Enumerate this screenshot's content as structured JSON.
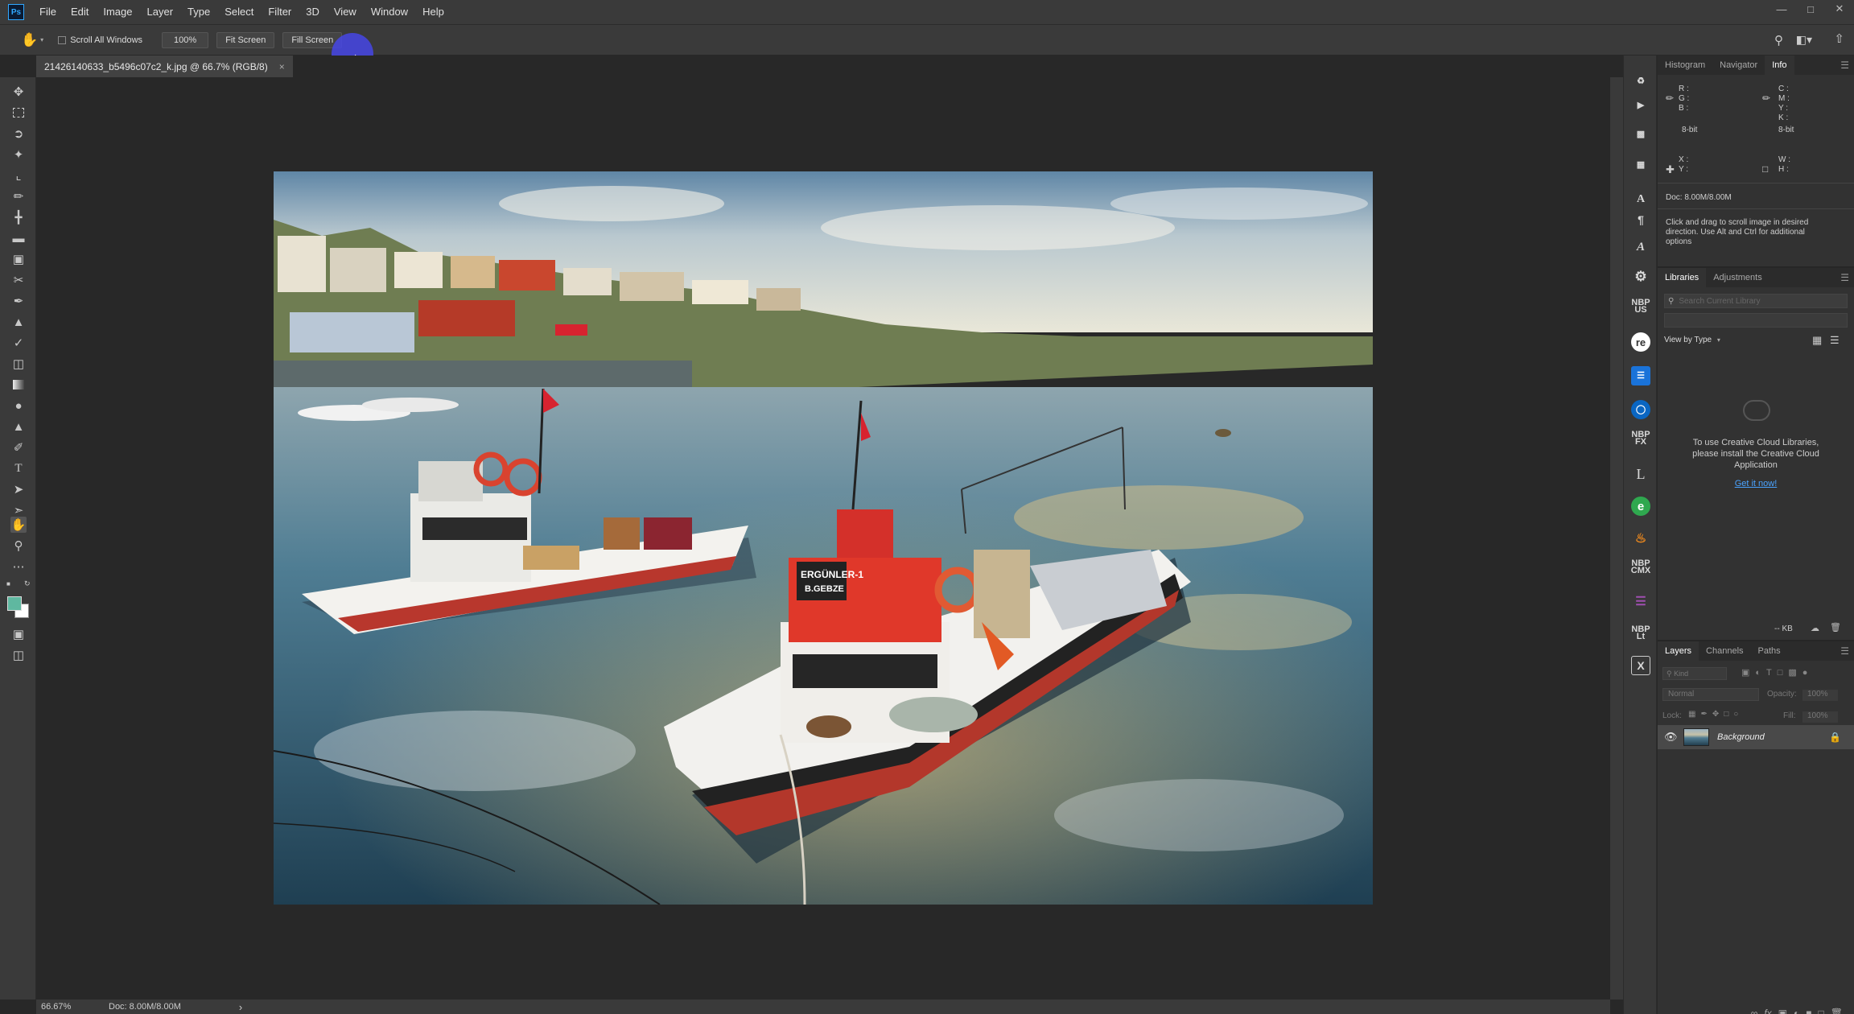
{
  "app": {
    "logo": "Ps"
  },
  "menu": [
    "File",
    "Edit",
    "Image",
    "Layer",
    "Type",
    "Select",
    "Filter",
    "3D",
    "View",
    "Window",
    "Help"
  ],
  "options": {
    "scroll_all_windows": "Scroll All Windows",
    "zoom_100": "100%",
    "fit_screen": "Fit Screen",
    "fill_screen": "Fill Screen"
  },
  "document": {
    "tab_title": "21426140633_b5496c07c2_k.jpg @ 66.7% (RGB/8)",
    "close": "×"
  },
  "status": {
    "zoom": "66.67%",
    "doc": "Doc: 8.00M/8.00M",
    "arrow": "›"
  },
  "info_panel": {
    "tabs": [
      "Histogram",
      "Navigator",
      "Info"
    ],
    "rgb": "R :\nG :\nB :",
    "cmyk": "C :\nM :\nY :\nK :",
    "bit_left": "8-bit",
    "bit_right": "8-bit",
    "xy": "X :\nY :",
    "wh": "W :\nH :",
    "doc": "Doc: 8.00M/8.00M",
    "hint": "Click and drag to scroll image in desired direction.  Use Alt and Ctrl for additional options"
  },
  "libraries_panel": {
    "tabs": [
      "Libraries",
      "Adjustments"
    ],
    "search_placeholder": "Search Current Library",
    "view_by": "View by Type",
    "message": "To use Creative Cloud Libraries, please install the Creative Cloud Application",
    "link": "Get it now!",
    "size": "-- KB"
  },
  "layers_panel": {
    "tabs": [
      "Layers",
      "Channels",
      "Paths"
    ],
    "kind": "Kind",
    "blend_mode": "Normal",
    "opacity_label": "Opacity:",
    "opacity_value": "100%",
    "lock_label": "Lock:",
    "fill_label": "Fill:",
    "fill_value": "100%",
    "layer_name": "Background"
  },
  "plugin_strip": {
    "nbp1": "NBP\nUS",
    "re": "re",
    "nbp2": "NBP\nFX",
    "nbp3": "NBP\nCMX",
    "nbp4": "NBP\nLt"
  },
  "colors": {
    "accent": "#31a8ff",
    "link": "#4aa3ff",
    "fg_swatch": "#5fb8a0",
    "bg_swatch": "#ffffff"
  }
}
